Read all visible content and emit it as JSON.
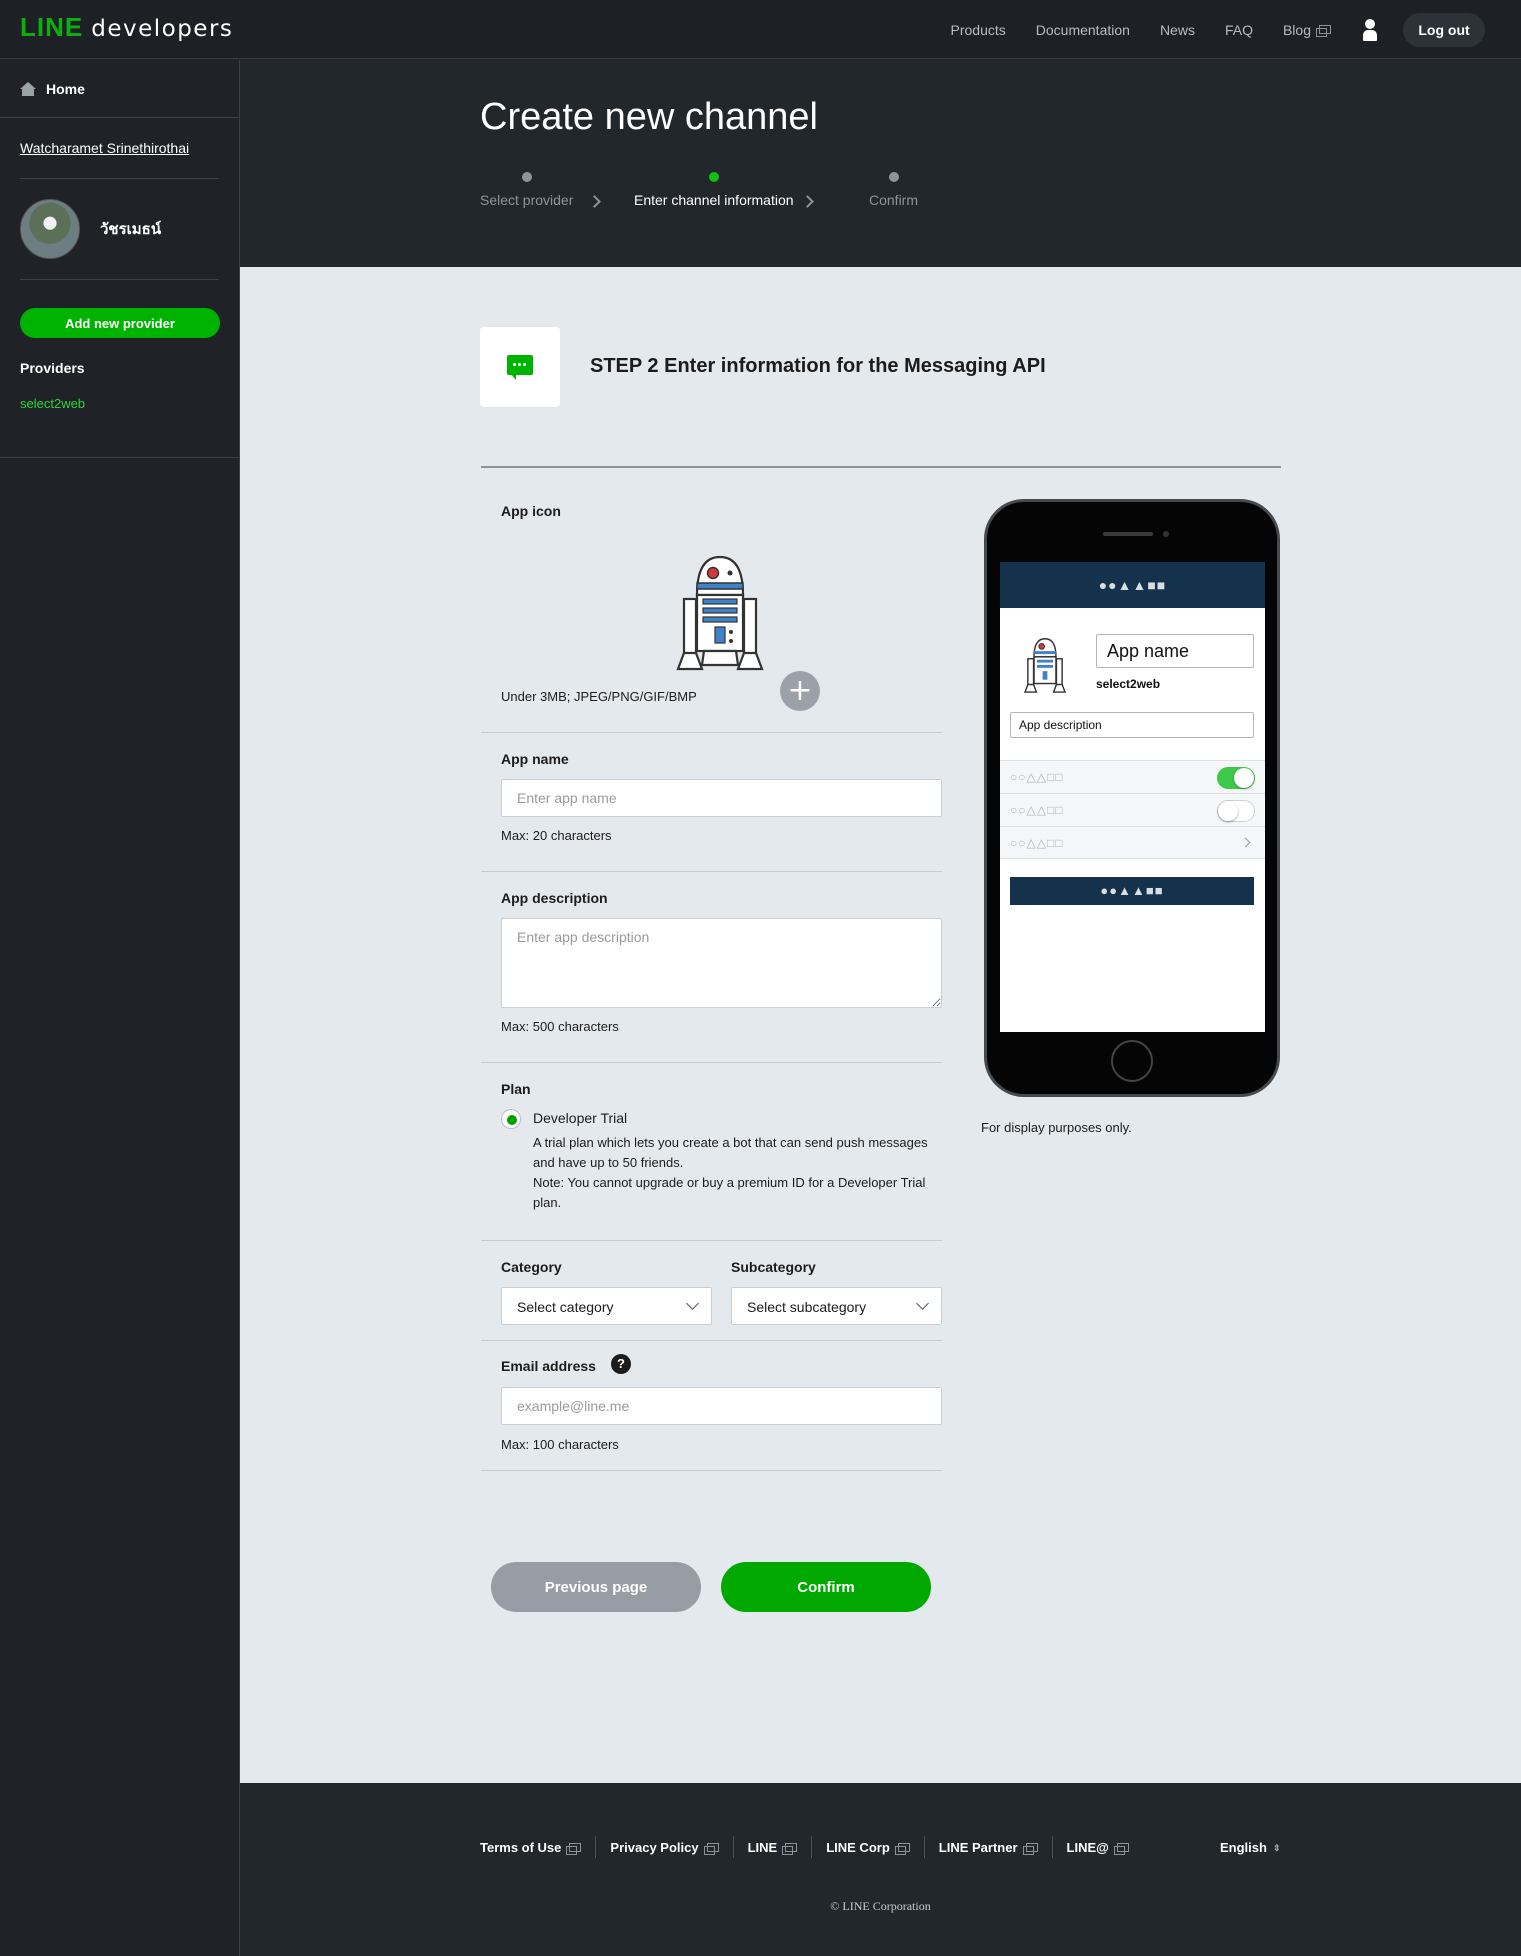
{
  "header": {
    "logo_line": "LINE",
    "logo_developers": "developers",
    "nav": [
      "Products",
      "Documentation",
      "News",
      "FAQ",
      "Blog"
    ],
    "logout_label": "Log out"
  },
  "sidebar": {
    "home_label": "Home",
    "username": "Watcharamet Srinethirothai",
    "display_name": "วัชรเมธน์",
    "add_provider_label": "Add new provider",
    "providers_heading": "Providers",
    "providers": [
      "select2web"
    ]
  },
  "page": {
    "title": "Create new channel",
    "steps": [
      "Select provider",
      "Enter channel information",
      "Confirm"
    ],
    "active_step": 2,
    "step_title": "STEP 2 Enter information for the Messaging API"
  },
  "form": {
    "app_icon_label": "App icon",
    "app_icon_hint": "Under 3MB; JPEG/PNG/GIF/BMP",
    "app_name_label": "App name",
    "app_name_placeholder": "Enter app name",
    "app_name_hint": "Max: 20 characters",
    "app_desc_label": "App description",
    "app_desc_placeholder": "Enter app description",
    "app_desc_hint": "Max: 500 characters",
    "plan_label": "Plan",
    "plan_name": "Developer Trial",
    "plan_desc": "A trial plan which lets you create a bot that can send push messages and have up to 50 friends.",
    "plan_note": "Note: You cannot upgrade or buy a premium ID for a Developer Trial plan.",
    "category_label": "Category",
    "category_value": "Select category",
    "subcategory_label": "Subcategory",
    "subcategory_value": "Select subcategory",
    "email_label": "Email address",
    "email_placeholder": "example@line.me",
    "email_hint": "Max: 100 characters",
    "prev_label": "Previous page",
    "confirm_label": "Confirm"
  },
  "preview": {
    "header_shapes": "●●▲▲■■",
    "app_name": "App name",
    "provider": "select2web",
    "app_description": "App description",
    "row_shapes": "○○△△□□",
    "toggle1_on": true,
    "toggle2_on": false,
    "button_shapes": "●●▲▲■■",
    "note": "For display purposes only."
  },
  "footer": {
    "links": [
      "Terms of Use",
      "Privacy Policy",
      "LINE",
      "LINE Corp",
      "LINE Partner",
      "LINE@"
    ],
    "language": "English",
    "copyright": "© LINE Corporation"
  },
  "colors": {
    "brand_green": "#00b300",
    "dark_bg": "#22272c",
    "content_bg": "#e4e9ed",
    "preview_header": "#14324b"
  }
}
